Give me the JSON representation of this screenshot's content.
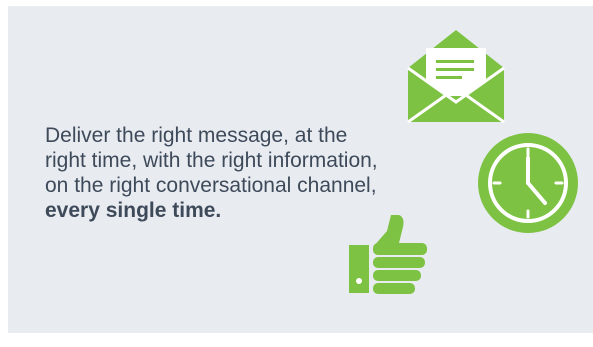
{
  "message": {
    "lines": [
      "Deliver the right message, at the",
      "right time, with the right information,",
      "on the right conversational channel,"
    ],
    "emphasis": "every single time."
  },
  "icons": [
    "envelope-icon",
    "clock-icon",
    "thumbs-up-icon"
  ],
  "colors": {
    "background": "#e8ecf1",
    "text": "#3e4a5a",
    "accent_green": "#7dc242"
  }
}
